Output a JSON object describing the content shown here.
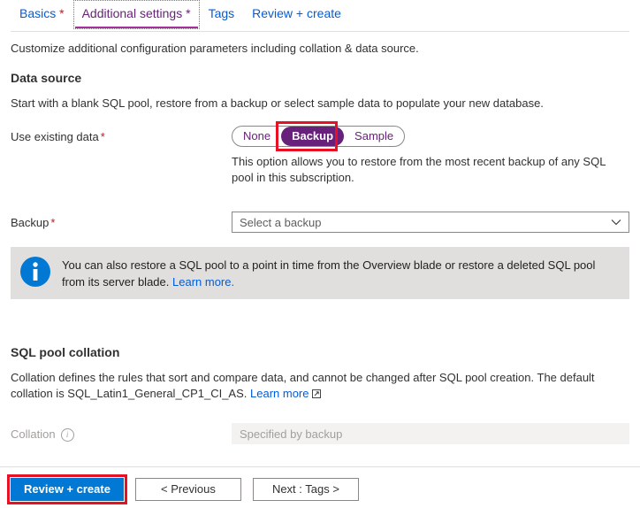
{
  "tabs": [
    {
      "label": "Basics",
      "required": true,
      "active": false
    },
    {
      "label": "Additional settings",
      "required": true,
      "active": true
    },
    {
      "label": "Tags",
      "required": false,
      "active": false
    },
    {
      "label": "Review + create",
      "required": false,
      "active": false
    }
  ],
  "intro": "Customize additional configuration parameters including collation & data source.",
  "data_source": {
    "title": "Data source",
    "description": "Start with a blank SQL pool, restore from a backup or select sample data to populate your new database.",
    "use_existing_data": {
      "label": "Use existing data",
      "required_marker": "*",
      "options": [
        "None",
        "Backup",
        "Sample"
      ],
      "selected": "Backup",
      "hint": "This option allows you to restore from the most recent backup of any SQL pool in this subscription."
    },
    "backup": {
      "label": "Backup",
      "required_marker": "*",
      "placeholder": "Select a backup",
      "chevron_icon": "chevron-down-icon"
    },
    "banner": {
      "icon": "info-circle-icon",
      "text": "You can also restore a SQL pool to a point in time from the Overview blade or restore a deleted SQL pool from its server blade.",
      "link_label": "Learn more."
    }
  },
  "collation_section": {
    "title": "SQL pool collation",
    "description_part1": "Collation defines the rules that sort and compare data, and cannot be changed after SQL pool creation. The default collation is SQL_Latin1_General_CP1_CI_AS.",
    "link_label": "Learn more",
    "link_icon": "external-link-icon",
    "field": {
      "label": "Collation",
      "info_icon": "info-tooltip-icon",
      "value": "Specified by backup",
      "disabled": true
    }
  },
  "footer": {
    "review_create": "Review + create",
    "previous": "< Previous",
    "next": "Next : Tags >"
  },
  "colors": {
    "accent_blue": "#0078d4",
    "link_blue": "#015cda",
    "azure_purple": "#68217a",
    "tab_underline": "#a4309c",
    "required_red": "#a4262c",
    "annotation_red": "#e81123",
    "banner_bg": "#e1dfdd",
    "disabled_bg": "#f3f2f1"
  }
}
